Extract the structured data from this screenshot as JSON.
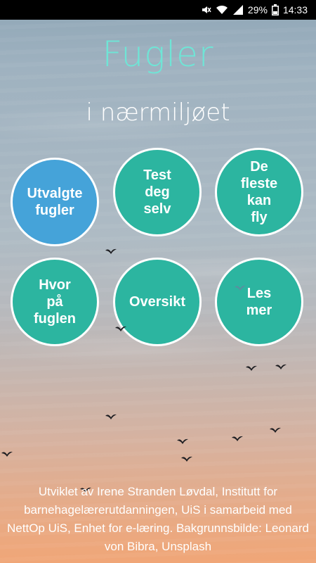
{
  "status_bar": {
    "battery_percent": "29%",
    "time": "14:33",
    "icons": [
      "mute-icon",
      "wifi-icon",
      "signal-icon",
      "battery-icon"
    ]
  },
  "header": {
    "title": "Fugler",
    "subtitle": "i nærmiljøet"
  },
  "menu": {
    "items": [
      {
        "label": "Utvalgte\nfugler",
        "selected": true
      },
      {
        "label": "Test\ndeg\nselv",
        "selected": false
      },
      {
        "label": "De\nfleste\nkan\nfly",
        "selected": false
      },
      {
        "label": "Hvor\npå\nfuglen",
        "selected": false
      },
      {
        "label": "Oversikt",
        "selected": false
      },
      {
        "label": "Les\nmer",
        "selected": false
      }
    ]
  },
  "footer": {
    "credits": "Utviklet av Irene Stranden Løvdal, Institutt for barnehagelærerutdanningen, UiS i samarbeid med NettOp UiS, Enhet for e-læring. Bakgrunnsbilde: Leonard von Bibra, Unsplash"
  },
  "colors": {
    "title": "#6fe5d6",
    "button": "#2cb5a0",
    "button_selected": "#45a3d9",
    "button_border": "#ffffff"
  }
}
